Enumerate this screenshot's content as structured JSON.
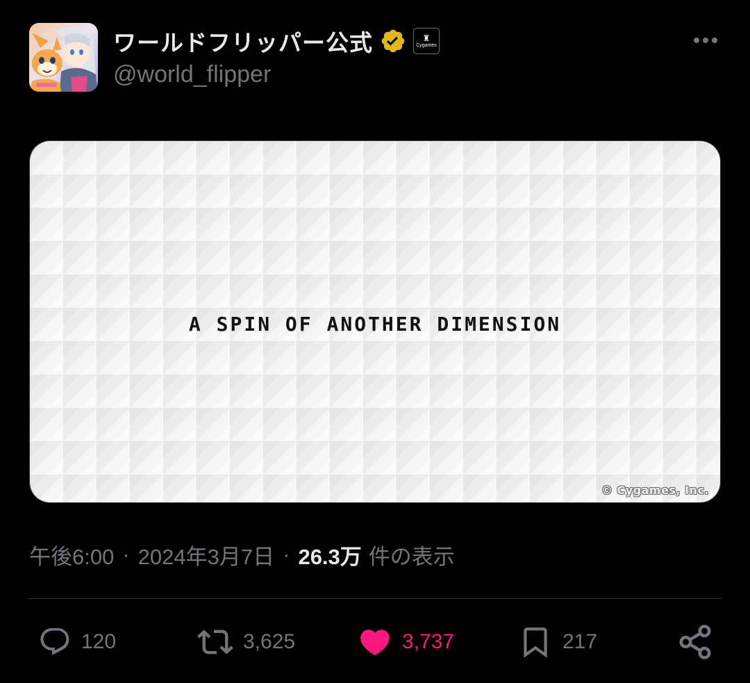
{
  "author": {
    "display_name": "ワールドフリッパー公式",
    "handle": "@world_flipper",
    "verified_icon": "verified-gold-badge",
    "affiliate_label": "Cygames"
  },
  "media": {
    "title": "A SPIN OF ANOTHER DIMENSION",
    "copyright": "© Cygames, Inc."
  },
  "meta": {
    "time": "午後6:00",
    "separator": "·",
    "date": "2024年3月7日",
    "views_count": "26.3万",
    "views_label": "件の表示"
  },
  "actions": {
    "replies": "120",
    "reposts": "3,625",
    "likes": "3,737",
    "bookmarks": "217"
  },
  "colors": {
    "background": "#000000",
    "primary_text": "#e7e9ea",
    "secondary_text": "#71767b",
    "like": "#f91880",
    "verified_gold": "#e2b719"
  }
}
